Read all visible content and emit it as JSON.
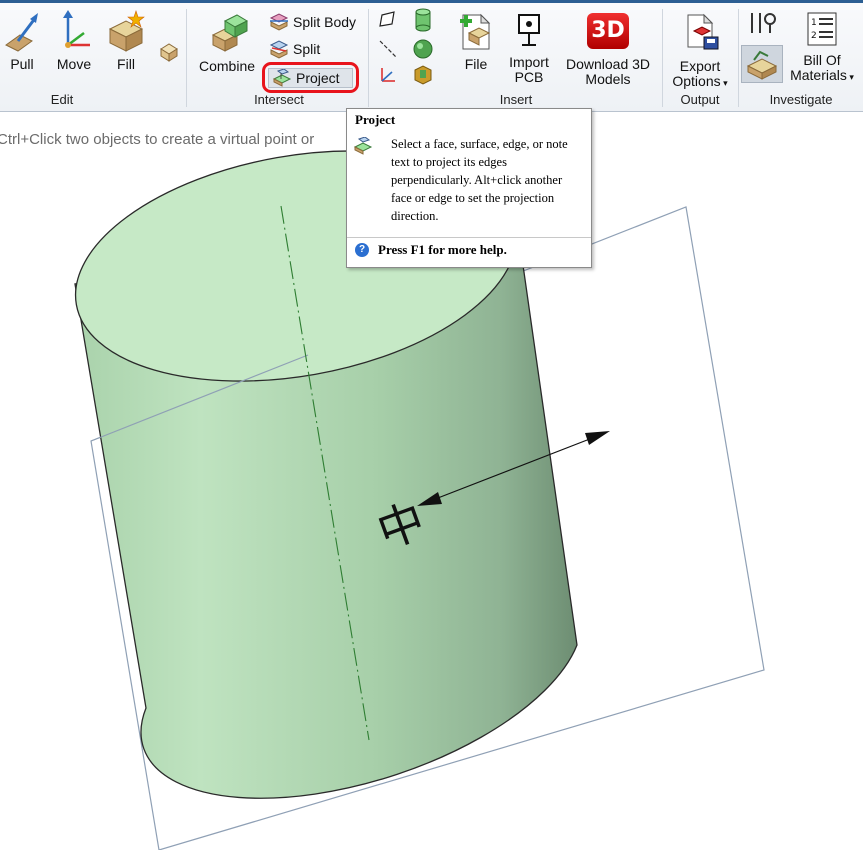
{
  "ribbon": {
    "groups": {
      "edit": "Edit",
      "intersect": "Intersect",
      "insert": "Insert",
      "output": "Output",
      "investigate": "Investigate"
    },
    "edit": {
      "pull": "Pull",
      "move": "Move",
      "fill": "Fill"
    },
    "intersect": {
      "combine": "Combine",
      "split_body": "Split Body",
      "split": "Split",
      "project": "Project"
    },
    "insert": {
      "file": "File",
      "import_pcb_1": "Import",
      "import_pcb_2": "PCB",
      "download_3d_1": "Download 3D",
      "download_3d_2": "Models"
    },
    "output": {
      "export_1": "Export",
      "export_2": "Options"
    },
    "investigate": {
      "bom_1": "Bill Of",
      "bom_2": "Materials"
    }
  },
  "status_hint": "Ctrl+Click two objects to create a virtual point or",
  "tooltip": {
    "title": "Project",
    "description": "Select a face, surface, edge, or note text to project its edges perpendicularly. Alt+click another face or edge to set the projection direction.",
    "help": "Press F1 for more help."
  },
  "scene": {
    "note_text": "中",
    "body_color": "#b7e1b8"
  },
  "icons": {
    "download_3d": "3D"
  }
}
